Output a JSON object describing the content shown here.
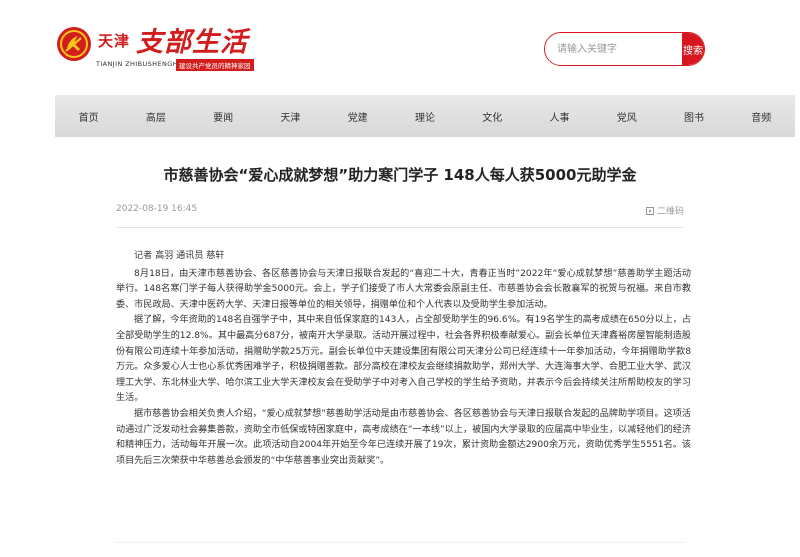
{
  "header": {
    "logo_cn_small": "天津",
    "logo_cn_big": "支部生活",
    "logo_en": "TIANJIN ZHIBUSHENGHUO",
    "logo_slogan": "建设共产党员的精神家园"
  },
  "search": {
    "placeholder": "请输入关键字",
    "button_label": "搜索"
  },
  "nav": {
    "items": [
      "首页",
      "高层",
      "要闻",
      "天津",
      "党建",
      "理论",
      "文化",
      "人事",
      "党风",
      "图书",
      "音频"
    ]
  },
  "article": {
    "title": "市慈善协会“爱心成就梦想”助力寒门学子 148人每人获5000元助学金",
    "date": "2022-08-19 16:45",
    "qr_label": "二维码",
    "byline": "记者 高羽 通讯员 慈轩",
    "paragraphs": [
      "8月18日，由天津市慈善协会、各区慈善协会与天津日报联合发起的“喜迎二十大，青春正当时”2022年“爱心成就梦想”慈善助学主题活动举行。148名寒门学子每人获得助学金5000元。会上，学子们接受了市人大常委会原副主任、市慈善协会会长散襄军的祝贺与祝福。来自市教委、市民政局、天津中医药大学、天津日报等单位的相关领导，捐赠单位和个人代表以及受助学生参加活动。",
      "据了解，今年资助的148名自强学子中，其中来自低保家庭的143人，占全部受助学生的96.6%。有19名学生的高考成绩在650分以上，占全部受助学生的12.8%。其中最高分687分，被南开大学录取。活动开展过程中，社会各界积极奉献爱心。副会长单位天津鑫裕房屋智能制造股份有限公司连续十年参加活动，捐赠助学款25万元。副会长单位中天建设集团有限公司天津分公司已经连续十一年参加活动，今年捐赠助学款8万元。众多爱心人士也心系优秀困难学子，积极捐赠善款。部分高校在津校友会继续捐款助学，郑州大学、大连海事大学、合肥工业大学、武汉理工大学、东北林业大学、哈尔滨工业大学天津校友会在受助学子中对考入自己学校的学生给予资助，并表示今后会持续关注所帮助校友的学习生活。",
      "据市慈善协会相关负责人介绍，“爱心成就梦想”慈善助学活动是由市慈善协会、各区慈善协会与天津日报联合发起的品牌助学项目。这项活动通过广泛发动社会募集善款，资助全市低保或特困家庭中，高考成绩在“一本线”以上，被国内大学录取的应届高中毕业生，以减轻他们的经济和精神压力，活动每年开展一次。此项活动自2004年开始至今年已连续开展了19次，累计资助金额达2900余万元，资助优秀学生5551名。该项目先后三次荣获中华慈善总会颁发的“中华慈善事业突出贡献奖”。"
    ]
  },
  "colors": {
    "brand_red": "#d21d1d",
    "search_red": "#d7171f",
    "nav_bg": "#e0e0e0"
  }
}
